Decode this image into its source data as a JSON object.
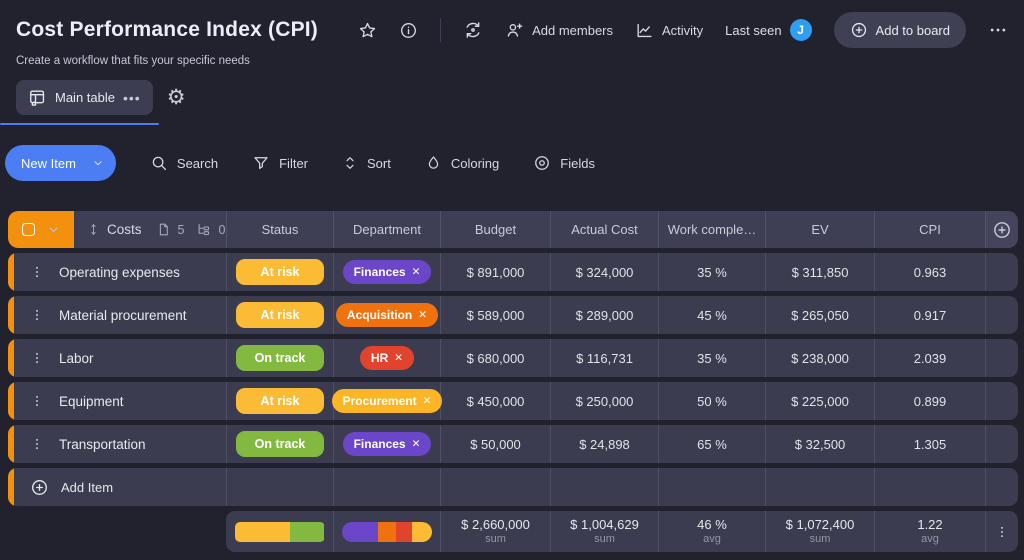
{
  "header": {
    "title": "Cost Performance Index (CPI)",
    "subtitle": "Create a workflow that fits your specific needs",
    "add_members": "Add members",
    "activity": "Activity",
    "last_seen": "Last seen",
    "avatar_initial": "J",
    "add_to_board": "Add to board"
  },
  "tabs": {
    "main_table": "Main table"
  },
  "toolbar": {
    "new_item": "New Item",
    "search": "Search",
    "filter": "Filter",
    "sort": "Sort",
    "coloring": "Coloring",
    "fields": "Fields"
  },
  "group": {
    "name": "Costs",
    "docs_count": "5",
    "subitems_count": "0"
  },
  "columns": {
    "status": "Status",
    "department": "Department",
    "budget": "Budget",
    "actual": "Actual Cost",
    "work": "Work comple…",
    "ev": "EV",
    "cpi": "CPI"
  },
  "rows": [
    {
      "name": "Operating expenses",
      "status": {
        "label": "At risk",
        "color": "#fcbb34"
      },
      "dept": {
        "label": "Finances",
        "color": "#6c46c9"
      },
      "budget": "$ 891,000",
      "actual": "$ 324,000",
      "work": "35 %",
      "ev": "$ 311,850",
      "cpi": "0.963"
    },
    {
      "name": "Material procurement",
      "status": {
        "label": "At risk",
        "color": "#fcbb34"
      },
      "dept": {
        "label": "Acquisition",
        "color": "#f0720e"
      },
      "budget": "$ 589,000",
      "actual": "$ 289,000",
      "work": "45 %",
      "ev": "$ 265,050",
      "cpi": "0.917"
    },
    {
      "name": "Labor",
      "status": {
        "label": "On track",
        "color": "#83b940"
      },
      "dept": {
        "label": "HR",
        "color": "#e2432d"
      },
      "budget": "$ 680,000",
      "actual": "$ 116,731",
      "work": "35 %",
      "ev": "$ 238,000",
      "cpi": "2.039"
    },
    {
      "name": "Equipment",
      "status": {
        "label": "At risk",
        "color": "#fcbb34"
      },
      "dept": {
        "label": "Procurement",
        "color": "#fcb525"
      },
      "budget": "$ 450,000",
      "actual": "$ 250,000",
      "work": "50 %",
      "ev": "$ 225,000",
      "cpi": "0.899"
    },
    {
      "name": "Transportation",
      "status": {
        "label": "On track",
        "color": "#83b940"
      },
      "dept": {
        "label": "Finances",
        "color": "#6c46c9"
      },
      "budget": "$ 50,000",
      "actual": "$ 24,898",
      "work": "65 %",
      "ev": "$ 32,500",
      "cpi": "1.305"
    }
  ],
  "add_item": "Add Item",
  "summary": {
    "status_distribution": [
      {
        "color": "#fcbb34",
        "pct": 62
      },
      {
        "color": "#83b940",
        "pct": 38
      }
    ],
    "dept_distribution": [
      {
        "color": "#6c46c9",
        "pct": 40
      },
      {
        "color": "#f0720e",
        "pct": 20
      },
      {
        "color": "#e2432d",
        "pct": 18
      },
      {
        "color": "#fcbb34",
        "pct": 22
      }
    ],
    "budget": {
      "value": "$ 2,660,000",
      "agg": "sum"
    },
    "actual": {
      "value": "$ 1,004,629",
      "agg": "sum"
    },
    "work": {
      "value": "46 %",
      "agg": "avg"
    },
    "ev": {
      "value": "$ 1,072,400",
      "agg": "sum"
    },
    "cpi": {
      "value": "1.22",
      "agg": "avg"
    }
  },
  "icons": {
    "remove": "✕"
  },
  "colors": {
    "accent_orange": "#f3910e",
    "primary_blue": "#4d7df2",
    "avatar_blue": "#2e9df2",
    "tab_underline": "#4d7cf5"
  }
}
